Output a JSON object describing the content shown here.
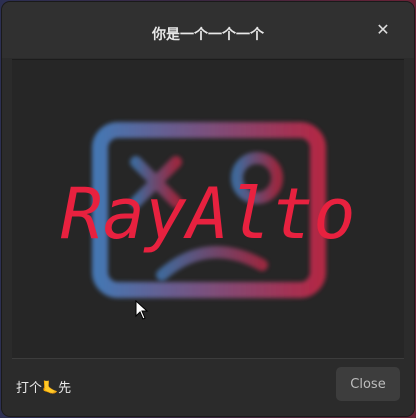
{
  "dialog": {
    "title": "你是一个一个一个",
    "close_icon": "close-icon"
  },
  "content": {
    "logo_text": "RayAlto",
    "logo_icon": "sad-face-icon",
    "colors": {
      "gradient_start": "#4a7fc1",
      "gradient_end": "#c1294a",
      "text": "#e8213f"
    }
  },
  "footer": {
    "label": "打个🦶先",
    "close_label": "Close"
  },
  "pointer": "mouse-pointer-icon"
}
